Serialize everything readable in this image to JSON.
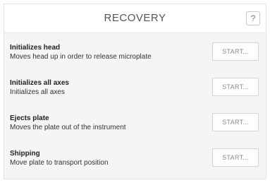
{
  "header": {
    "title": "RECOVERY",
    "help_label": "?"
  },
  "actions": [
    {
      "name": "Initializes head",
      "description": "Moves head up in order to release microplate",
      "button_label": "START..."
    },
    {
      "name": "Initializes all axes",
      "description": "Initializes all axes",
      "button_label": "START..."
    },
    {
      "name": "Ejects plate",
      "description": "Moves the plate out of the instrument",
      "button_label": "START..."
    },
    {
      "name": "Shipping",
      "description": "Move plate to transport position",
      "button_label": "START..."
    }
  ]
}
